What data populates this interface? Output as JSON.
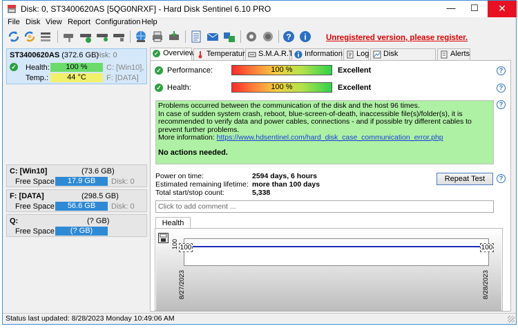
{
  "window": {
    "title": "Disk: 0, ST3400620AS [5QG0NRXF] - Hard Disk Sentinel 6.10 PRO",
    "controls": {
      "minimize": "—",
      "maximize": "☐",
      "close": "✕"
    }
  },
  "menu": {
    "items": [
      "File",
      "Disk",
      "View",
      "Report",
      "Configuration",
      "Help"
    ]
  },
  "toolbar": {
    "icons": [
      "refresh-icon",
      "rescan-icon",
      "disk-list-icon",
      "disk-tool-icon",
      "disk-check-icon",
      "disk-settings-icon",
      "disk-info-icon",
      "network-icon",
      "printer-icon",
      "save-disk-icon",
      "report-icon",
      "email-icon",
      "share-icon",
      "settings-icon",
      "sound-icon",
      "help-icon",
      "about-icon"
    ],
    "unregistered_text": "Unregistered version, please register."
  },
  "disk": {
    "name": "ST3400620AS",
    "size": "(372.6 GB)",
    "disk_label": "Disk: 0",
    "health_label": "Health:",
    "health_value": "100 %",
    "health_drive": "C: [Win10],",
    "temp_label": "Temp.:",
    "temp_value": "44 °C",
    "temp_drive": "F: [DATA]"
  },
  "volumes": [
    {
      "name": "C: [Win10]",
      "size": "(73.6 GB)",
      "free_label": "Free Space",
      "free": "17.9 GB",
      "disk": "Disk: 0"
    },
    {
      "name": "F: [DATA]",
      "size": "(298.5 GB)",
      "free_label": "Free Space",
      "free": "56.6 GB",
      "disk": "Disk: 0"
    },
    {
      "name": "Q:",
      "size": "(? GB)",
      "free_label": "Free Space",
      "free": "(? GB)",
      "disk": ""
    }
  ],
  "tabs": [
    {
      "label": "Overview",
      "icon": "check-icon",
      "active": true
    },
    {
      "label": "Temperature",
      "icon": "thermometer-icon",
      "active": false
    },
    {
      "label": "S.M.A.R.T.",
      "icon": "smart-icon",
      "active": false
    },
    {
      "label": "Information",
      "icon": "info-icon",
      "active": false
    },
    {
      "label": "Log",
      "icon": "log-icon",
      "active": false
    },
    {
      "label": "Disk Performance",
      "icon": "performance-icon",
      "active": false
    },
    {
      "label": "Alerts",
      "icon": "alerts-icon",
      "active": false
    }
  ],
  "overview": {
    "performance_label": "Performance:",
    "performance_value": "100 %",
    "performance_rating": "Excellent",
    "health_label": "Health:",
    "health_value": "100 %",
    "health_rating": "Excellent",
    "message_line1": "Problems occurred between the communication of the disk and the host 96 times.",
    "message_line2": "In case of sudden system crash, reboot, blue-screen-of-death, inaccessible file(s)/folder(s), it is recommended to verify data and power cables, connections - and if possible try different cables to prevent further problems.",
    "more_info_label": "More information:",
    "more_info_link": "https://www.hdsentinel.com/hard_disk_case_communication_error.php",
    "no_actions": "No actions needed.",
    "power_on_label": "Power on time:",
    "power_on_value": "2594 days, 6 hours",
    "lifetime_label": "Estimated remaining lifetime:",
    "lifetime_value": "more than 100 days",
    "startstop_label": "Total start/stop count:",
    "startstop_value": "5,338",
    "repeat_button": "Repeat Test",
    "comment_placeholder": "Click to add comment ..."
  },
  "health_chart_tab": "Health (%)",
  "chart_data": {
    "type": "line",
    "x": [
      "8/27/2023",
      "8/28/2023"
    ],
    "series": [
      {
        "values": [
          100,
          100
        ]
      }
    ],
    "ytick": "100",
    "data_labels": [
      "100",
      "100"
    ]
  },
  "status": {
    "text": "Status last updated: 8/28/2023 Monday 10:49:06 AM"
  },
  "colors": {
    "health_green": "#6bdc6b",
    "temp_yellow": "#f1f06b",
    "free_space_blue": "#2f8ad6",
    "message_green": "#aef0a4",
    "unregistered_red": "#e00000"
  }
}
